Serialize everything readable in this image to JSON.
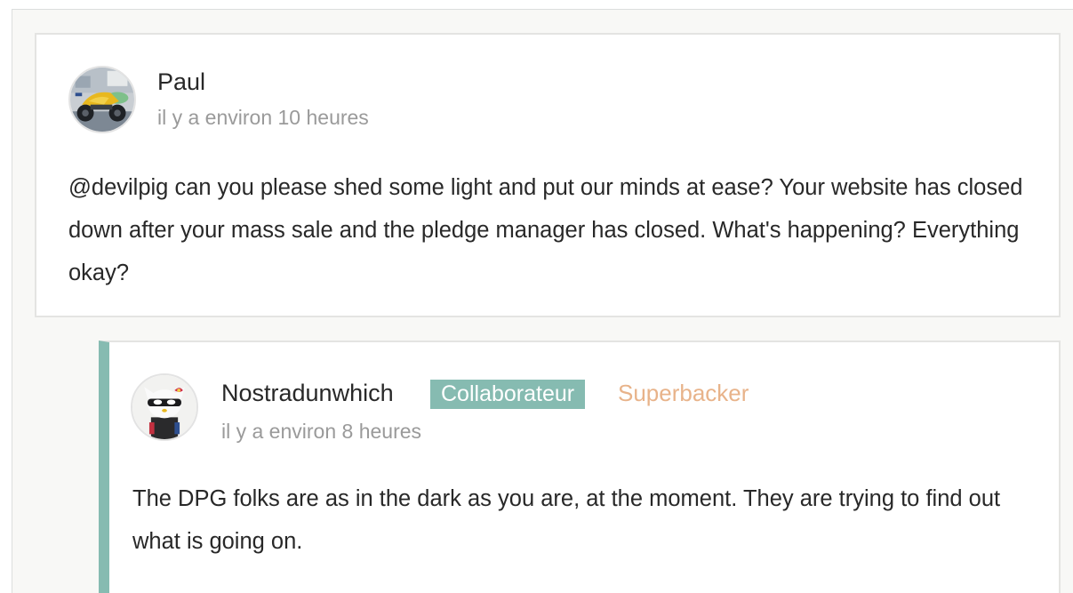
{
  "comments": [
    {
      "author": "Paul",
      "time": "il y a environ 10 heures",
      "avatar_icon": "motorcycle-avatar",
      "body": "@devilpig can you please shed some light and put our minds at ease? Your website has closed down after your mass sale and the pledge manager has closed. What's happening? Everything okay?"
    }
  ],
  "reply": {
    "author": "Nostradunwhich",
    "badge_collaborator": "Collaborateur",
    "badge_superbacker": "Superbacker",
    "time": "il y a environ 8 heures",
    "avatar_icon": "masked-cat-figure-avatar",
    "body": "The DPG folks are as in the dark as you are, at the moment. They are trying to find out what is going on."
  },
  "colors": {
    "accent_teal": "#86bbb1",
    "superbacker_orange": "#e8b38a",
    "muted_text": "#9a9a9a"
  }
}
